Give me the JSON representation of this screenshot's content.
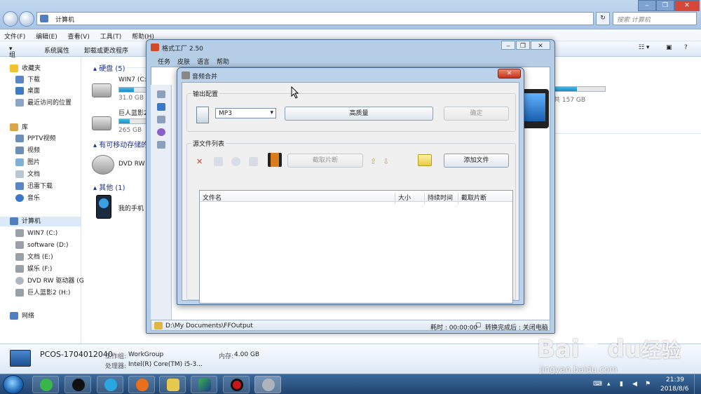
{
  "explorer": {
    "breadcrumb": "计算机",
    "search_placeholder": "搜索 计算机",
    "menu": [
      "文件(F)",
      "编辑(E)",
      "查看(V)",
      "工具(T)",
      "帮助(H)"
    ],
    "toolbar": {
      "organize": "组织",
      "system_props": "系统属性",
      "uninstall": "卸载或更改程序"
    },
    "nav": {
      "favorites": "收藏夹",
      "fav_items": [
        "下载",
        "桌面",
        "最近访问的位置"
      ],
      "libraries": "库",
      "lib_items": [
        "PPTV视频",
        "视频",
        "图片",
        "文档",
        "迅雷下载",
        "音乐"
      ],
      "computer": "计算机",
      "drives": [
        "WIN7 (C:)",
        "software (D:)",
        "文档 (E:)",
        "娱乐 (F:)",
        "DVD RW 驱动器 (G",
        "巨人蓝影2 (H:)"
      ],
      "network": "网络"
    },
    "groups": {
      "hdd": "硬盘 (5)",
      "removable": "有可移动存储的",
      "other": "其他 (1)"
    },
    "items": {
      "win7_name": "WIN7 (C:",
      "win7_free": "31.0 GB",
      "giant_name": "巨人蓝影2",
      "giant_free": "265 GB",
      "right_free": "共 157 GB",
      "dvd": "DVD RW",
      "phone": "我的手机"
    },
    "usage": {
      "win7": 0.55,
      "giant": 0.4,
      "right": 0.45
    },
    "details": {
      "pc_name": "PCOS-1704012040",
      "workgroup_label": "工作组:",
      "workgroup": "WorkGroup",
      "memory_label": "内存:",
      "memory": "4.00 GB",
      "cpu_label": "处理器:",
      "cpu": "Intel(R) Core(TM) i5-3..."
    }
  },
  "formatfactory": {
    "title": "格式工厂 2.50",
    "menu": [
      "任务",
      "皮肤",
      "语言",
      "帮助"
    ],
    "output_path": "D:\\My Documents\\FFOutput",
    "elapsed": "耗时 : 00:00:00",
    "after_convert": "转换完成后 : 关闭电脑"
  },
  "dialog": {
    "title": "音频合并",
    "output_group": "输出配置",
    "format_value": "MP3",
    "quality_button": "高质量",
    "ok_button": "确定",
    "source_group": "源文件列表",
    "clip_button": "截取片断",
    "add_file_button": "添加文件",
    "columns": [
      "文件名",
      "大小",
      "持续时间",
      "截取片断"
    ]
  },
  "taskbar": {
    "time": "21:39",
    "date": "2018/8/6"
  },
  "watermark": {
    "brand": "Bai",
    "brand_end": "du",
    "cn": "经验",
    "url": "jingyan.baidu.com"
  },
  "colors": {
    "accent": "#1a8cc8",
    "titlebar": "#a9c5e6",
    "taskbar": "#20446e"
  }
}
